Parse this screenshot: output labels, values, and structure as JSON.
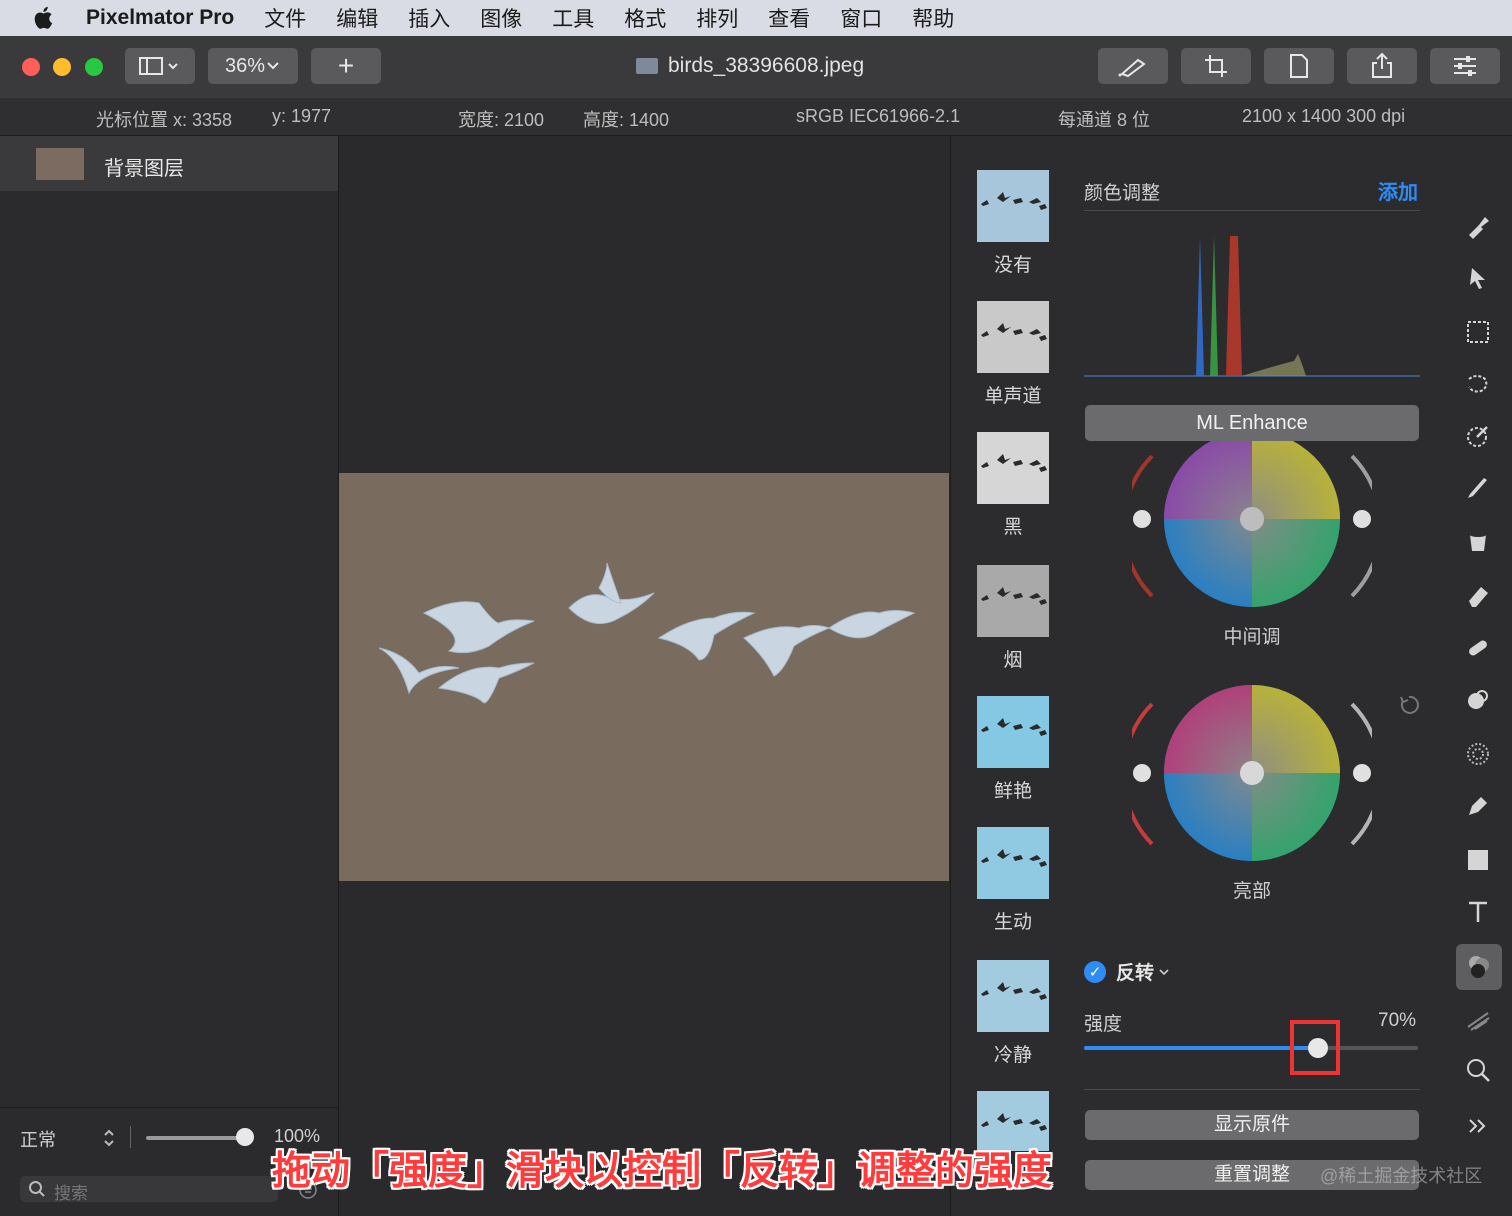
{
  "menubar": {
    "app_name": "Pixelmator Pro",
    "items": [
      "文件",
      "编辑",
      "插入",
      "图像",
      "工具",
      "格式",
      "排列",
      "查看",
      "窗口",
      "帮助"
    ]
  },
  "toolbar": {
    "zoom": "36%",
    "add_label": "+",
    "document_title": "birds_38396608.jpeg"
  },
  "infobar": {
    "cursor_x": "光标位置 x:  3358",
    "cursor_y": "y:  1977",
    "width": "宽度:  2100",
    "height": "高度:  1400",
    "color_profile": "sRGB IEC61966-2.1",
    "bit_depth": "每通道 8 位",
    "dimensions": "2100 x 1400 300 dpi"
  },
  "layers": {
    "items": [
      {
        "name": "背景图层"
      }
    ],
    "blend_mode": "正常",
    "opacity": "100%",
    "search_placeholder": "搜索"
  },
  "presets": [
    "没有",
    "单声道",
    "黑",
    "烟",
    "鲜艳",
    "生动",
    "冷静"
  ],
  "adjustments": {
    "title": "颜色调整",
    "add": "添加",
    "ml_enhance": "ML Enhance",
    "wheel_midtones": "中间调",
    "wheel_highlights": "亮部",
    "invert_label": "反转",
    "strength_label": "强度",
    "strength_value": "70%",
    "strength_fraction": 0.7,
    "show_original": "显示原件",
    "reset": "重置调整"
  },
  "caption": "拖动「强度」滑块以控制「反转」调整的强度",
  "watermark": "@稀土掘金技术社区",
  "colors": {
    "accent": "#2f8cf5",
    "highlight": "#ee3333",
    "close": "#fe5f57",
    "minimize": "#febc2e",
    "zoom": "#28c840"
  }
}
